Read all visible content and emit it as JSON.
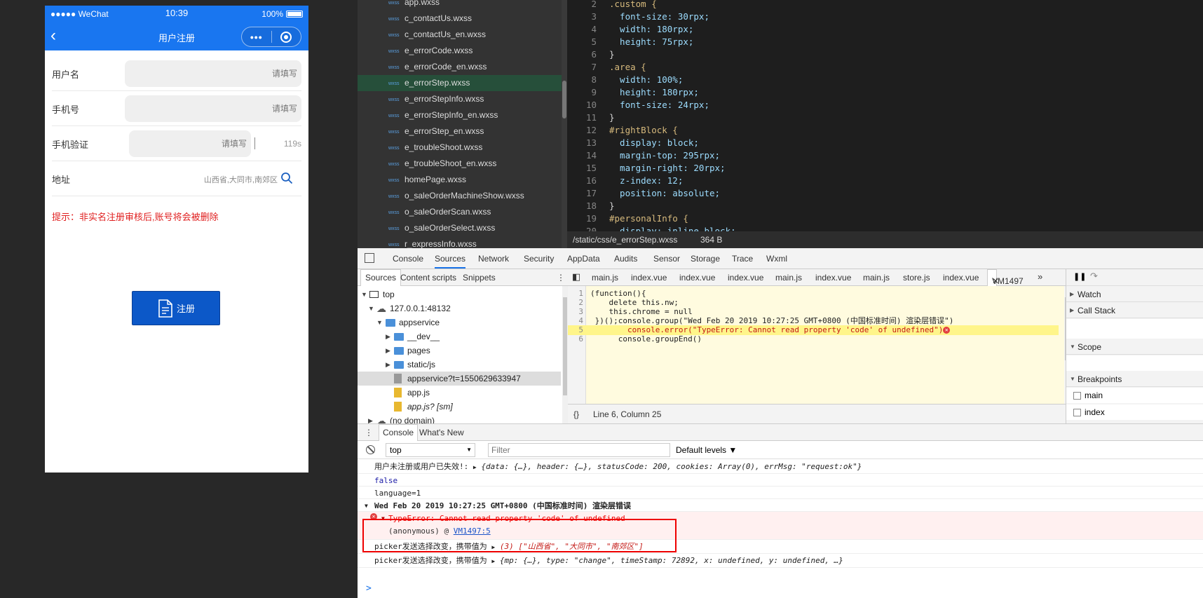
{
  "phone": {
    "statusbar": {
      "carrier": "●●●●● WeChat",
      "time": "10:39",
      "battery": "100%"
    },
    "nav": {
      "title": "用户注册"
    },
    "form": {
      "username": {
        "label": "用户名",
        "placeholder": "请填写"
      },
      "phone": {
        "label": "手机号",
        "placeholder": "请填写"
      },
      "verify": {
        "label": "手机验证",
        "placeholder": "请填写",
        "countdown": "119s"
      },
      "address": {
        "label": "地址",
        "value": "山西省,大同市,南郊区"
      }
    },
    "hint": "提示：非实名注册审核后,账号将会被删除",
    "register_button": "注册"
  },
  "file_tree": {
    "items": [
      {
        "type": "wxss",
        "name": "app.wxss"
      },
      {
        "type": "wxss",
        "name": "c_contactUs.wxss"
      },
      {
        "type": "wxss",
        "name": "c_contactUs_en.wxss"
      },
      {
        "type": "wxss",
        "name": "e_errorCode.wxss"
      },
      {
        "type": "wxss",
        "name": "e_errorCode_en.wxss"
      },
      {
        "type": "wxss",
        "name": "e_errorStep.wxss"
      },
      {
        "type": "wxss",
        "name": "e_errorStepInfo.wxss"
      },
      {
        "type": "wxss",
        "name": "e_errorStepInfo_en.wxss"
      },
      {
        "type": "wxss",
        "name": "e_errorStep_en.wxss"
      },
      {
        "type": "wxss",
        "name": "e_troubleShoot.wxss"
      },
      {
        "type": "wxss",
        "name": "e_troubleShoot_en.wxss"
      },
      {
        "type": "wxss",
        "name": "homePage.wxss"
      },
      {
        "type": "wxss",
        "name": "o_saleOrderMachineShow.wxss"
      },
      {
        "type": "wxss",
        "name": "o_saleOrderScan.wxss"
      },
      {
        "type": "wxss",
        "name": "o_saleOrderSelect.wxss"
      },
      {
        "type": "wxss",
        "name": "r_expressInfo.wxss"
      }
    ]
  },
  "editor": {
    "lines": [
      {
        "n": "2",
        "t": ".custom {"
      },
      {
        "n": "3",
        "t": "  font-size: 30rpx;"
      },
      {
        "n": "4",
        "t": "  width: 180rpx;"
      },
      {
        "n": "5",
        "t": "  height: 75rpx;"
      },
      {
        "n": "6",
        "t": "}"
      },
      {
        "n": "7",
        "t": ".area {"
      },
      {
        "n": "8",
        "t": "  width: 100%;"
      },
      {
        "n": "9",
        "t": "  height: 180rpx;"
      },
      {
        "n": "10",
        "t": "  font-size: 24rpx;"
      },
      {
        "n": "11",
        "t": "}"
      },
      {
        "n": "12",
        "t": "#rightBlock {"
      },
      {
        "n": "13",
        "t": "  display: block;"
      },
      {
        "n": "14",
        "t": "  margin-top: 295rpx;"
      },
      {
        "n": "15",
        "t": "  margin-right: 20rpx;"
      },
      {
        "n": "16",
        "t": "  z-index: 12;"
      },
      {
        "n": "17",
        "t": "  position: absolute;"
      },
      {
        "n": "18",
        "t": "}"
      },
      {
        "n": "19",
        "t": "#personalInfo {"
      },
      {
        "n": "20",
        "t": "  display: inline-block;"
      }
    ],
    "path": "/static/css/e_errorStep.wxss",
    "size": "364 B"
  },
  "devtools_tabs": [
    "Console",
    "Sources",
    "Network",
    "Security",
    "AppData",
    "Audits",
    "Sensor",
    "Storage",
    "Trace",
    "Wxml"
  ],
  "sources_nav": {
    "tabs": [
      "Sources",
      "Content scripts",
      "Snippets"
    ],
    "tree": {
      "top": "top",
      "host": "127.0.0.1:48132",
      "appservice": "appservice",
      "dev": "__dev__",
      "pages": "pages",
      "static": "static/js",
      "appservice_file": "appservice?t=1550629633947",
      "appjs": "app.js",
      "appjs_sm": "app.js? [sm]",
      "nodomain": "(no domain)"
    }
  },
  "file_tabs": [
    "main.js",
    "index.vue",
    "index.vue",
    "index.vue",
    "main.js",
    "index.vue",
    "main.js",
    "store.js",
    "index.vue",
    "VM1497"
  ],
  "code2": {
    "lines": [
      {
        "n": "1",
        "t": "(function(){"
      },
      {
        "n": "2",
        "t": "    delete this.nw;"
      },
      {
        "n": "3",
        "t": "    this.chrome = null"
      },
      {
        "n": "4",
        "t": " })();console.group(\"Wed Feb 20 2019 10:27:25 GMT+0800 (中国标准时间) 渲染层错误\")"
      },
      {
        "n": "5",
        "t": "        console.error(\"TypeError: Cannot read property 'code' of undefined\")"
      },
      {
        "n": "6",
        "t": "      console.groupEnd()"
      }
    ],
    "status": "Line 6, Column 25"
  },
  "debugger": {
    "watch": "Watch",
    "callstack": "Call Stack",
    "scope": "Scope",
    "breakpoints": "Breakpoints",
    "bp1": "main",
    "bp2": "index"
  },
  "drawer": {
    "tabs": [
      "Console",
      "What's New"
    ],
    "context": "top",
    "filter_placeholder": "Filter",
    "levels": "Default levels"
  },
  "console": {
    "r1_label": "用户未注册或用户已失效!:",
    "r1_obj": "{data: {…}, header: {…}, statusCode: 200, cookies: Array(0), errMsg: \"request:ok\"}",
    "r2": "false",
    "r3": "language=1",
    "r4": "Wed Feb 20 2019 10:27:25 GMT+0800 (中国标准时间) 渲染层错误",
    "r5": "TypeError: Cannot read property 'code' of undefined",
    "r6_pre": "(anonymous) @ ",
    "r6_link": "VM1497:5",
    "r7_label": "picker发送选择改变，携带值为",
    "r7_obj": "(3) [\"山西省\", \"大同市\", \"南郊区\"]",
    "r8_label": "picker发送选择改变，携带值为",
    "r8_obj": "{mp: {…}, type: \"change\", timeStamp: 72892, x: undefined, y: undefined, …}",
    "prompt": ">"
  }
}
